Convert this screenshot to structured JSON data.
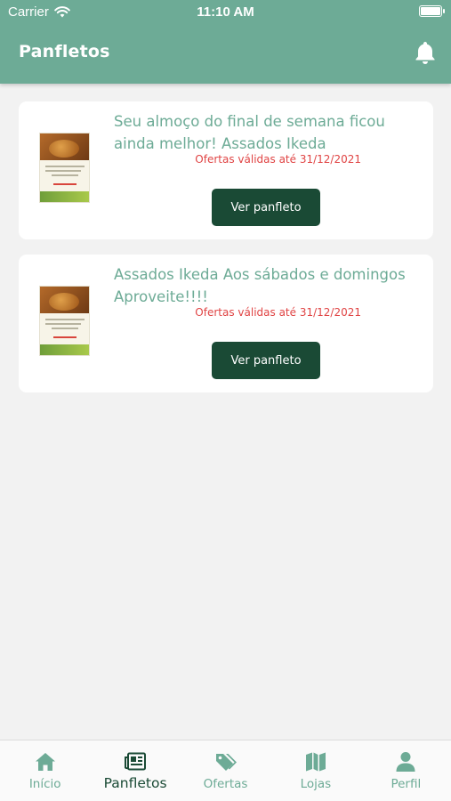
{
  "status_bar": {
    "carrier": "Carrier",
    "time": "11:10 AM"
  },
  "header": {
    "title": "Panfletos",
    "notification_icon": "bell-icon"
  },
  "colors": {
    "primary": "#6dab96",
    "dark_green": "#1a4a35",
    "validity_red": "#e04444",
    "background": "#f2f2f2"
  },
  "flyers": [
    {
      "title": "Seu almoço do final de semana ficou ainda melhor! Assados Ikeda",
      "validity": "Ofertas válidas até 31/12/2021",
      "button_label": "Ver panfleto"
    },
    {
      "title": "Assados Ikeda Aos sábados e domingos Aproveite!!!!",
      "validity": "Ofertas válidas até 31/12/2021",
      "button_label": "Ver panfleto"
    }
  ],
  "tabbar": {
    "items": [
      {
        "label": "Início",
        "icon": "home-icon",
        "active": false
      },
      {
        "label": "Panfletos",
        "icon": "newspaper-icon",
        "active": true
      },
      {
        "label": "Ofertas",
        "icon": "tags-icon",
        "active": false
      },
      {
        "label": "Lojas",
        "icon": "map-icon",
        "active": false
      },
      {
        "label": "Perfil",
        "icon": "user-icon",
        "active": false
      }
    ]
  }
}
